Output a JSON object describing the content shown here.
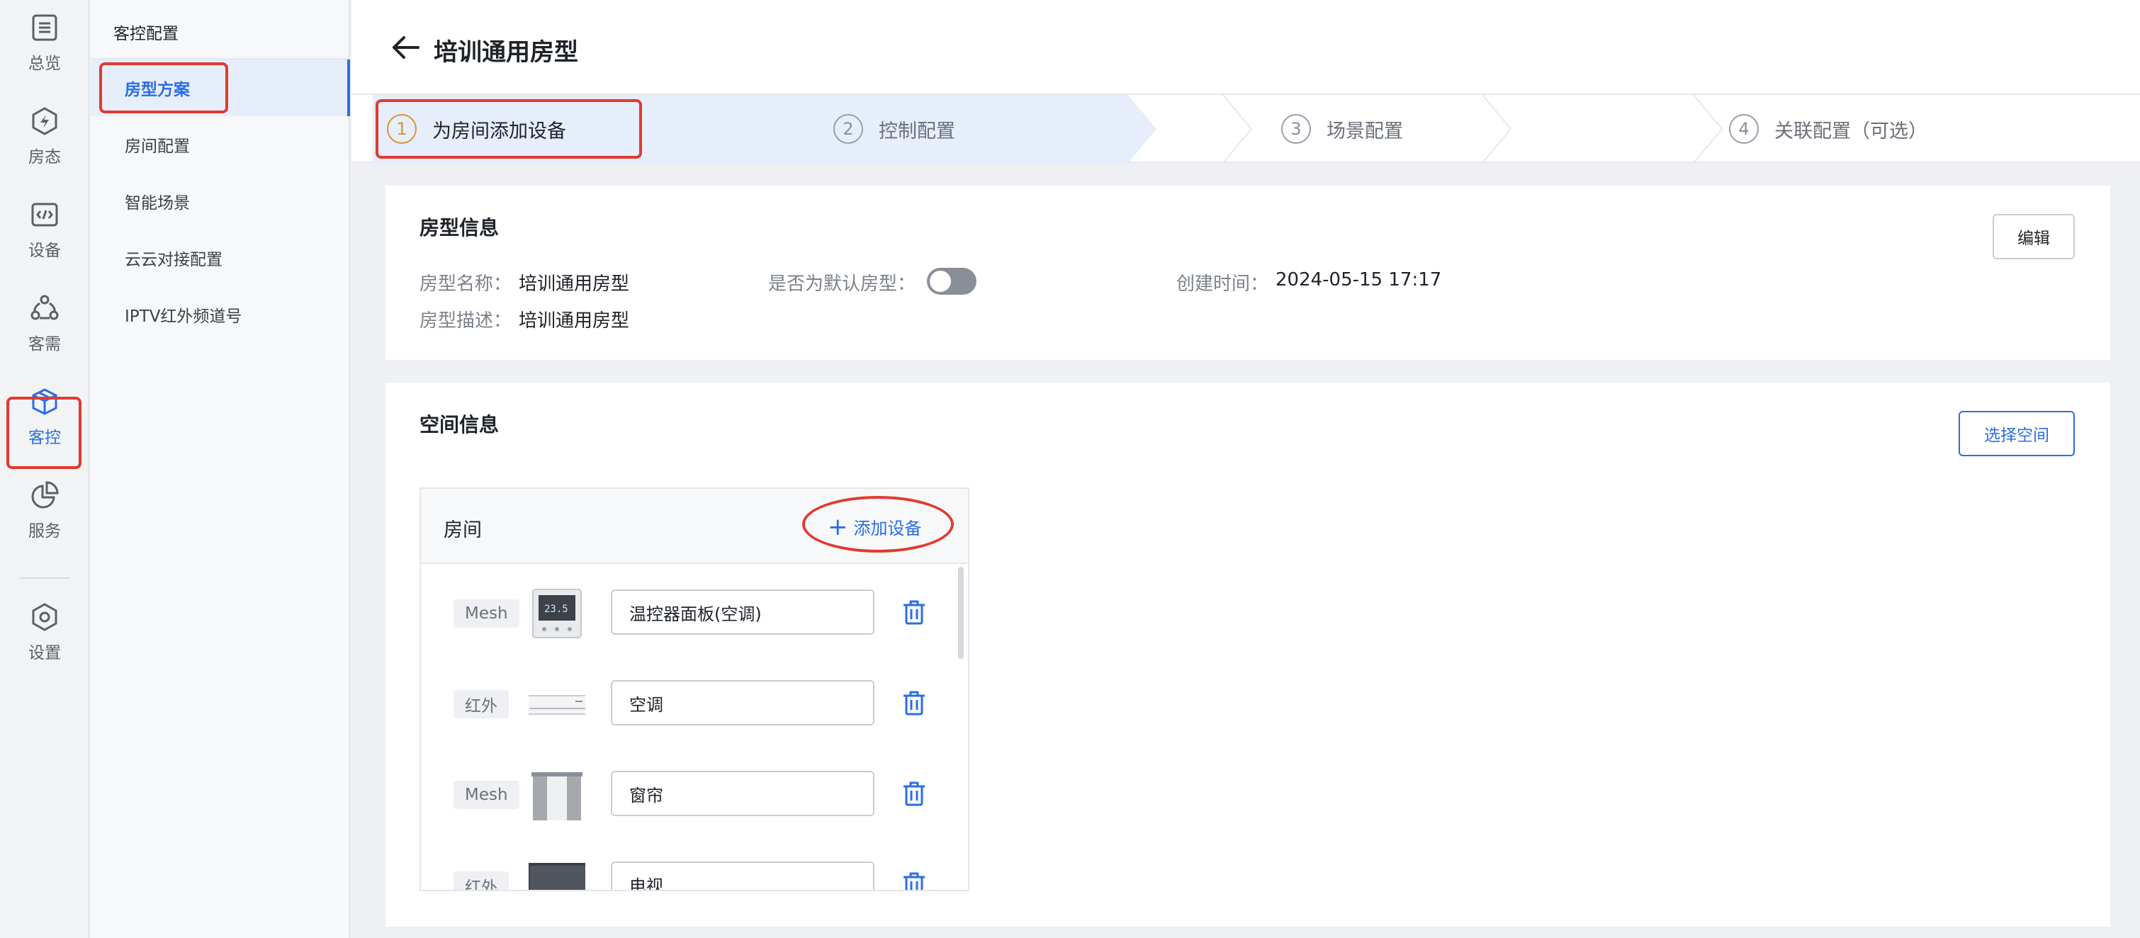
{
  "rail": {
    "items": [
      {
        "label": "总览",
        "icon": "list-icon"
      },
      {
        "label": "房态",
        "icon": "bolt-icon"
      },
      {
        "label": "设备",
        "icon": "code-icon"
      },
      {
        "label": "客需",
        "icon": "cluster-icon"
      },
      {
        "label": "客控",
        "icon": "cube-icon"
      },
      {
        "label": "服务",
        "icon": "pie-icon"
      },
      {
        "label": "设置",
        "icon": "hexagon-gear-icon"
      }
    ],
    "active": "客控"
  },
  "submenu": {
    "title": "客控配置",
    "items": [
      {
        "label": "房型方案"
      },
      {
        "label": "房间配置"
      },
      {
        "label": "智能场景"
      },
      {
        "label": "云云对接配置"
      },
      {
        "label": "IPTV红外频道号"
      }
    ],
    "active": "房型方案"
  },
  "header": {
    "title": "培训通用房型"
  },
  "steps": [
    {
      "num": "1",
      "label": "为房间添加设备"
    },
    {
      "num": "2",
      "label": "控制配置"
    },
    {
      "num": "3",
      "label": "场景配置"
    },
    {
      "num": "4",
      "label": "关联配置（可选）"
    }
  ],
  "room_type_info": {
    "title": "房型信息",
    "edit_label": "编辑",
    "name_label": "房型名称：",
    "name_value": "培训通用房型",
    "default_label": "是否为默认房型：",
    "default_on": false,
    "created_label": "创建时间：",
    "created_value": "2024-05-15 17:17",
    "desc_label": "房型描述：",
    "desc_value": "培训通用房型"
  },
  "space_info": {
    "title": "空间信息",
    "select_label": "选择空间",
    "room": {
      "title": "房间",
      "add_label": "添加设备",
      "devices": [
        {
          "tag": "Mesh",
          "name": "温控器面板(空调)",
          "thumb": "thermostat"
        },
        {
          "tag": "红外",
          "name": "空调",
          "thumb": "air-conditioner"
        },
        {
          "tag": "Mesh",
          "name": "窗帘",
          "thumb": "curtain"
        },
        {
          "tag": "红外",
          "name": "电视",
          "thumb": "tv"
        }
      ]
    }
  },
  "colors": {
    "accent": "#2b6de5",
    "highlight": "#e23a2f",
    "step_active": "#e0922f"
  }
}
